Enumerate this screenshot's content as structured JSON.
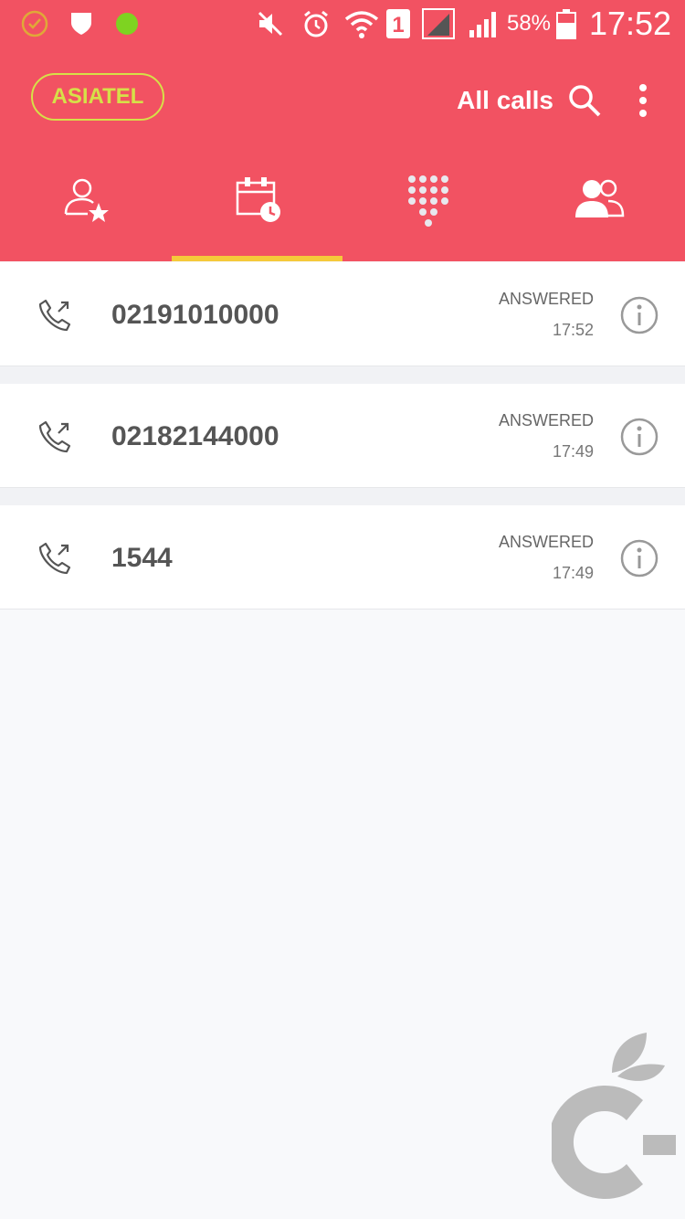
{
  "status_bar": {
    "battery_percent": "58%",
    "time": "17:52",
    "sim_slot": "1"
  },
  "app_bar": {
    "carrier": "ASIATEL",
    "filter": "All calls"
  },
  "tabs": [
    {
      "name": "favorites",
      "icon": "favorite-contact-icon"
    },
    {
      "name": "logs",
      "icon": "calendar-clock-icon",
      "selected": true
    },
    {
      "name": "keypad",
      "icon": "dialpad-icon"
    },
    {
      "name": "contacts",
      "icon": "contacts-icon"
    }
  ],
  "calls": [
    {
      "number": "02191010000",
      "status": "ANSWERED",
      "time": "17:52",
      "icon": "outgoing-call-icon"
    },
    {
      "number": "02182144000",
      "status": "ANSWERED",
      "time": "17:49",
      "icon": "outgoing-call-icon"
    },
    {
      "number": "1544",
      "status": "ANSWERED",
      "time": "17:49",
      "icon": "outgoing-call-icon"
    }
  ],
  "colors": {
    "header": "#f25262",
    "carrier_accent": "#d6e048",
    "tab_indicator": "#f5c93a"
  }
}
